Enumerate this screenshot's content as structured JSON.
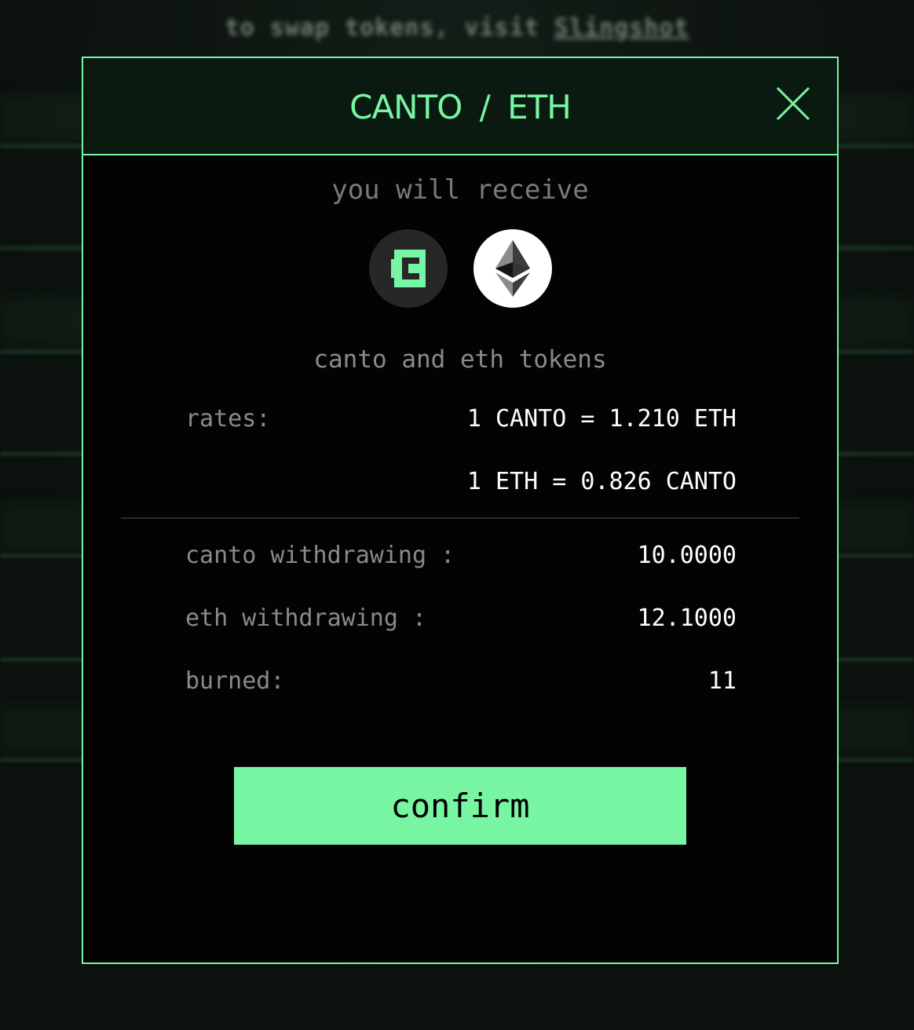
{
  "background": {
    "top_text_prefix": "to swap tokens, visit",
    "top_text_link": "Slingshot"
  },
  "modal": {
    "title": "CANTO / ETH",
    "close_icon": "close-icon",
    "receive_label": "you will receive",
    "tokens": [
      {
        "symbol": "CANTO",
        "icon": "canto-token-icon"
      },
      {
        "symbol": "ETH",
        "icon": "eth-token-icon"
      }
    ],
    "tokens_label": "canto and eth tokens",
    "rates_label": "rates:",
    "rate_1": "1 CANTO = 1.210 ETH",
    "rate_2": "1 ETH = 0.826 CANTO",
    "canto_withdrawing_label": "canto withdrawing :",
    "canto_withdrawing_value": "10.0000",
    "eth_withdrawing_label": "eth withdrawing :",
    "eth_withdrawing_value": "12.1000",
    "burned_label": "burned:",
    "burned_value": "11",
    "confirm_label": "confirm"
  },
  "colors": {
    "accent": "#78f5a3",
    "modal_background": "#030303",
    "header_background": "#0b1a10",
    "label_gray": "#8a8a8a",
    "value_white": "#ffffff"
  }
}
